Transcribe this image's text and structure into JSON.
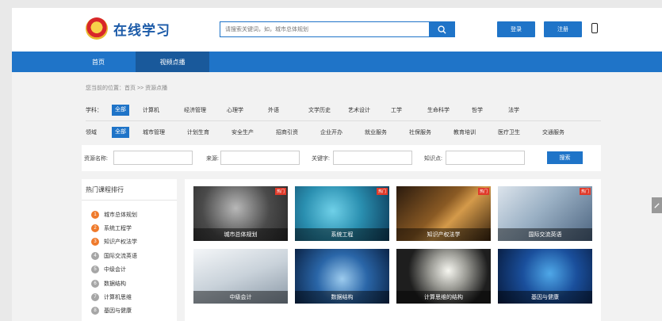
{
  "header": {
    "logo_text": "在线学习",
    "search_placeholder": "请搜索关键词，如，城市总体规划",
    "login_label": "登录",
    "register_label": "注册"
  },
  "nav": {
    "items": [
      "首页",
      "视频点播"
    ],
    "active": 1
  },
  "breadcrumb": "您当前的位置：首页 >> 资源点播",
  "filters": {
    "subject": {
      "label": "学科：",
      "options": [
        "全部",
        "计算机",
        "经济管理",
        "心理学",
        "外语",
        "文学历史",
        "艺术设计",
        "工学",
        "生命科学",
        "哲学",
        "法学"
      ]
    },
    "field": {
      "label": "领域",
      "options": [
        "全部",
        "城市管理",
        "计划生育",
        "安全生产",
        "招商引资",
        "企业开办",
        "就业服务",
        "社保服务",
        "教育培训",
        "医疗卫生",
        "交通服务"
      ]
    }
  },
  "search_form": {
    "resource_name_label": "资源名称:",
    "source_label": "来源:",
    "keyword_label": "关键字:",
    "knowledge_point_label": "知识点:",
    "search_button": "搜索"
  },
  "ranking": {
    "title": "热门课程排行",
    "items": [
      "城市总体规划",
      "系统工程学",
      "知识产权法学",
      "国际交流英语",
      "中级会计",
      "数据结构",
      "计算机思维",
      "基因与健康"
    ]
  },
  "courses": [
    {
      "title": "城市总体规划",
      "hot": "热门"
    },
    {
      "title": "系统工程",
      "hot": "热门"
    },
    {
      "title": "知识产权法学",
      "hot": "热门"
    },
    {
      "title": "国际交流英语",
      "hot": "热门"
    },
    {
      "title": "中级会计",
      "hot": ""
    },
    {
      "title": "数据结构",
      "hot": ""
    },
    {
      "title": "计算思维的结构",
      "hot": ""
    },
    {
      "title": "基因与健康",
      "hot": ""
    }
  ],
  "colors": {
    "brand_blue": "#1f74c8",
    "nav_active": "#19599b",
    "hot_red": "#e03a2a",
    "rank_orange": "#ef7a2b",
    "rank_gray": "#a6a6a6"
  }
}
